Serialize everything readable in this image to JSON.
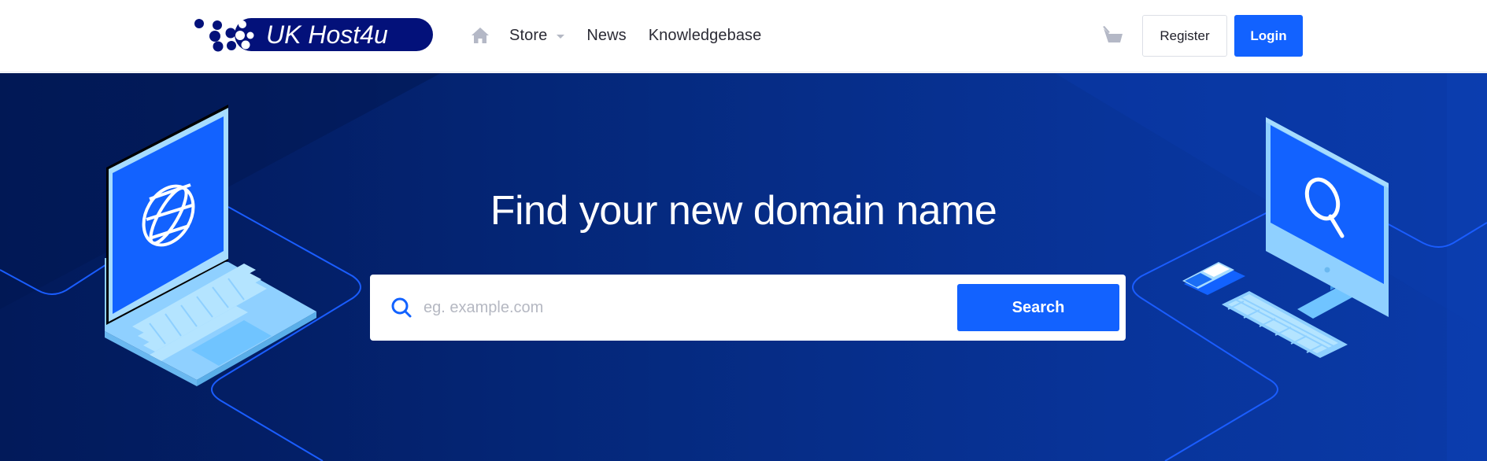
{
  "brand": {
    "name": "UK Host4u",
    "logo_color": "#03117a"
  },
  "nav": {
    "home_icon": "home-icon",
    "items": [
      {
        "label": "Store",
        "has_dropdown": true
      },
      {
        "label": "News",
        "has_dropdown": false
      },
      {
        "label": "Knowledgebase",
        "has_dropdown": false
      }
    ]
  },
  "header_actions": {
    "cart_icon": "basket-icon",
    "register_label": "Register",
    "login_label": "Login"
  },
  "hero": {
    "title": "Find your new domain name",
    "search": {
      "placeholder": "eg. example.com",
      "value": "",
      "button_label": "Search"
    },
    "illustrations": [
      "laptop-globe-illustration",
      "desktop-search-illustration"
    ]
  },
  "colors": {
    "accent": "#1262ff",
    "hero_dark": "#021a5a",
    "hero_light": "#0a3aa8",
    "device_light": "#8fd0ff"
  }
}
